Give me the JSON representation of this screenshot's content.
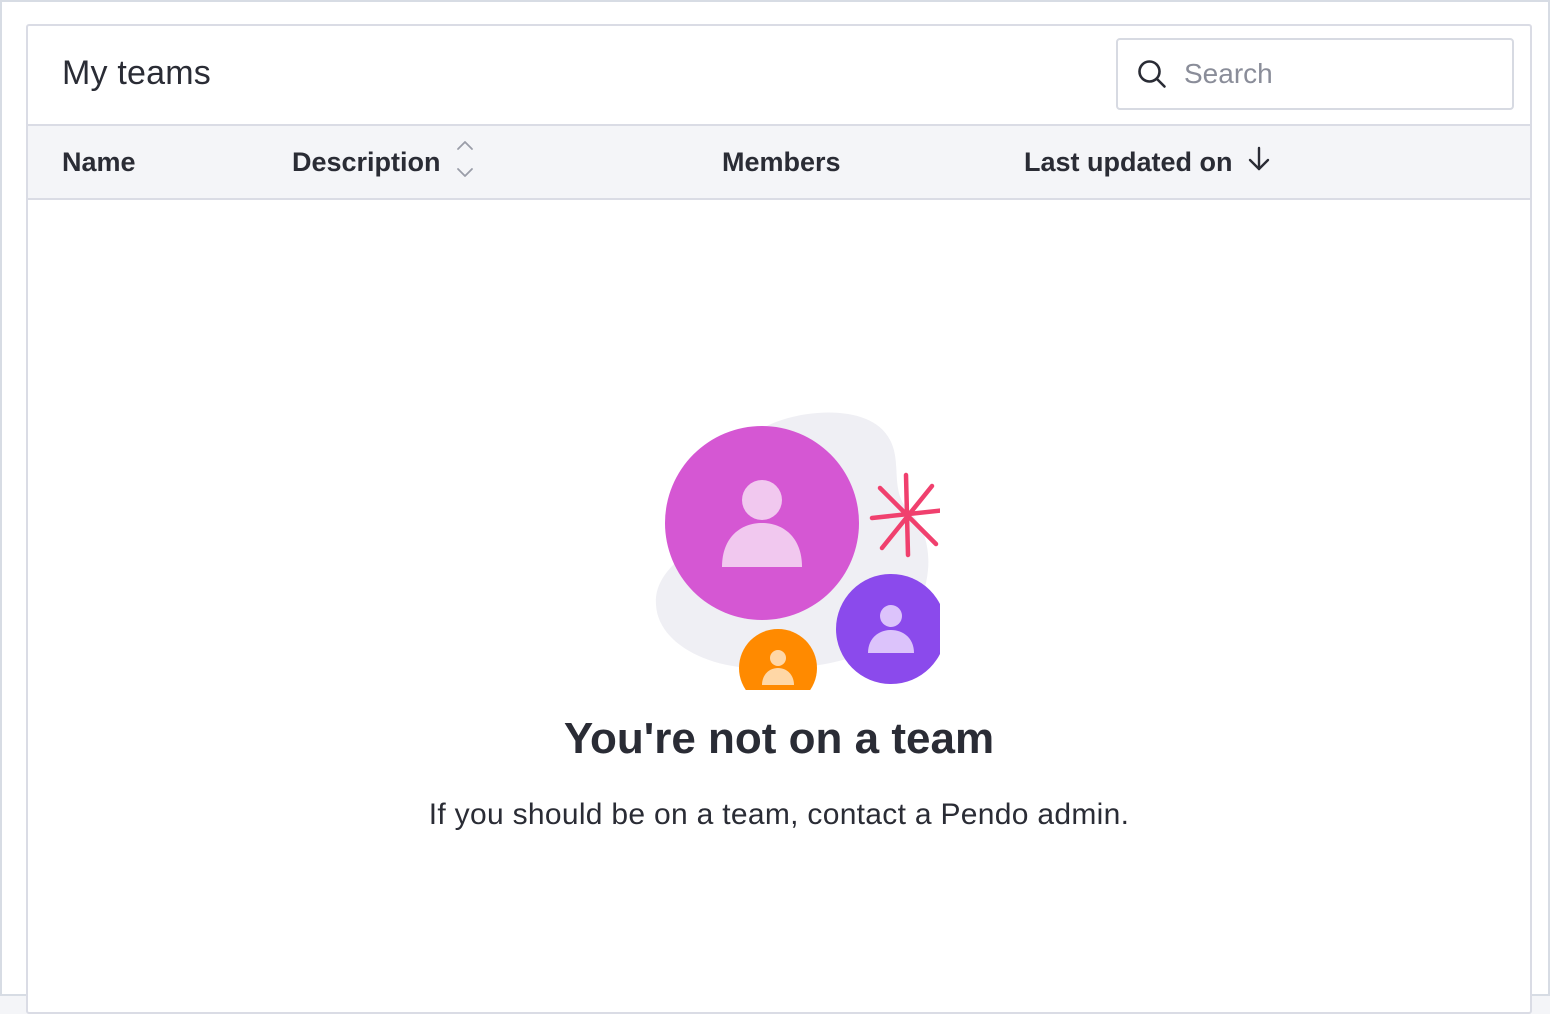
{
  "header": {
    "title": "My teams",
    "search": {
      "placeholder": "Search",
      "value": ""
    }
  },
  "table": {
    "columns": [
      {
        "label": "Name",
        "sortable": false
      },
      {
        "label": "Description",
        "sortable": true,
        "sort": "none"
      },
      {
        "label": "Members",
        "sortable": false
      },
      {
        "label": "Last updated on",
        "sortable": true,
        "sort": "descending"
      }
    ],
    "rows": []
  },
  "empty_state": {
    "title": "You're not on a team",
    "message": "If you should be on a team, contact a Pendo admin."
  },
  "colors": {
    "avatar_large": "#d557d3",
    "avatar_medium": "#8b4aec",
    "avatar_small": "#ff8a00",
    "sparkle": "#f0406e",
    "blob": "#efeff4"
  },
  "icons": {
    "search": "search-icon",
    "sort_none": "sort-icon",
    "sort_desc": "arrow-down-icon"
  }
}
